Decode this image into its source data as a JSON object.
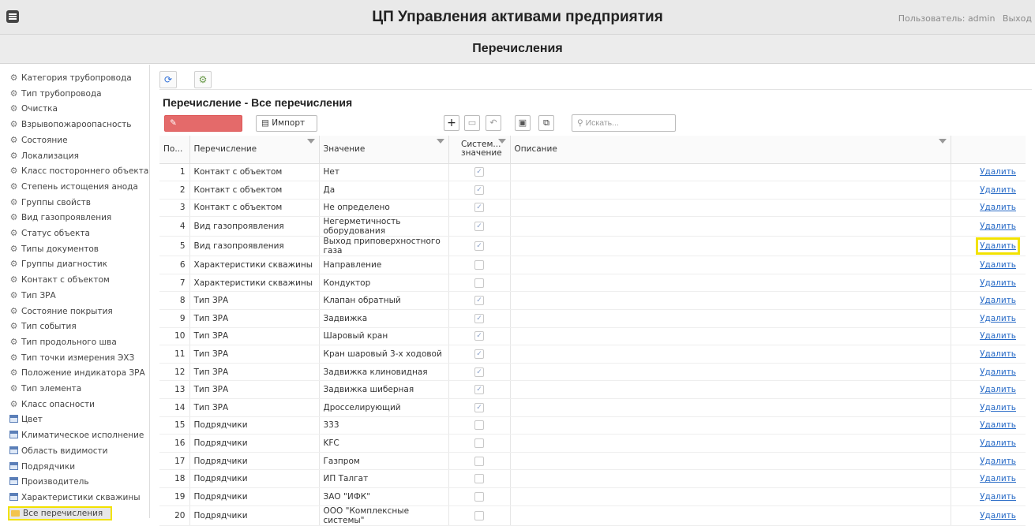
{
  "header": {
    "app_title": "ЦП Управления активами предприятия",
    "user_label": "Пользователь: admin",
    "logout_label": "Выход"
  },
  "page": {
    "title": "Перечисления"
  },
  "sidebar": {
    "items": [
      {
        "label": "Категория трубопровода",
        "icon": "gear-icon"
      },
      {
        "label": "Тип трубопровода",
        "icon": "gear-icon"
      },
      {
        "label": "Очистка",
        "icon": "gear-icon"
      },
      {
        "label": "Взрывопожароопасность",
        "icon": "gear-icon"
      },
      {
        "label": "Состояние",
        "icon": "gear-icon"
      },
      {
        "label": "Локализация",
        "icon": "gear-icon"
      },
      {
        "label": "Класс постороннего объекта",
        "icon": "gear-icon"
      },
      {
        "label": "Степень истощения анода",
        "icon": "gear-icon"
      },
      {
        "label": "Группы свойств",
        "icon": "gear-icon"
      },
      {
        "label": "Вид газопроявления",
        "icon": "gear-icon"
      },
      {
        "label": "Статус объекта",
        "icon": "gear-icon"
      },
      {
        "label": "Типы документов",
        "icon": "gear-icon"
      },
      {
        "label": "Группы диагностик",
        "icon": "gear-icon"
      },
      {
        "label": "Контакт с объектом",
        "icon": "gear-icon"
      },
      {
        "label": "Тип ЗРА",
        "icon": "gear-icon"
      },
      {
        "label": "Состояние покрытия",
        "icon": "gear-icon"
      },
      {
        "label": "Тип события",
        "icon": "gear-icon"
      },
      {
        "label": "Тип продольного шва",
        "icon": "gear-icon"
      },
      {
        "label": "Тип точки измерения ЭХЗ",
        "icon": "gear-icon"
      },
      {
        "label": "Положение индикатора ЗРА",
        "icon": "gear-icon"
      },
      {
        "label": "Тип элемента",
        "icon": "gear-icon"
      },
      {
        "label": "Класс опасности",
        "icon": "gear-icon"
      },
      {
        "label": "Цвет",
        "icon": "table-icon"
      },
      {
        "label": "Климатическое исполнение",
        "icon": "table-icon"
      },
      {
        "label": "Область видимости",
        "icon": "table-icon"
      },
      {
        "label": "Подрядчики",
        "icon": "table-icon"
      },
      {
        "label": "Производитель",
        "icon": "table-icon"
      },
      {
        "label": "Характеристики скважины",
        "icon": "table-icon"
      },
      {
        "label": "Все перечисления",
        "icon": "folder-icon"
      }
    ]
  },
  "panel": {
    "title": "Перечисление - Все перечисления",
    "edit_label": "Редактировать",
    "import_label": "Импорт",
    "search_placeholder": "Искать..."
  },
  "table": {
    "columns": [
      "По...",
      "Перечисление",
      "Значение",
      "Систем... значение",
      "Описание"
    ],
    "delete_label": "Удалить",
    "rows": [
      {
        "n": "1",
        "enum": "Контакт с объектом",
        "value": "Нет",
        "sys": true
      },
      {
        "n": "2",
        "enum": "Контакт с объектом",
        "value": "Да",
        "sys": true
      },
      {
        "n": "3",
        "enum": "Контакт с объектом",
        "value": "Не определено",
        "sys": true
      },
      {
        "n": "4",
        "enum": "Вид газопроявления",
        "value": "Негерметичность оборудования",
        "sys": true
      },
      {
        "n": "5",
        "enum": "Вид газопроявления",
        "value": "Выход приповерхностного газа",
        "sys": true
      },
      {
        "n": "6",
        "enum": "Характеристики скважины",
        "value": "Направление",
        "sys": false
      },
      {
        "n": "7",
        "enum": "Характеристики скважины",
        "value": "Кондуктор",
        "sys": false
      },
      {
        "n": "8",
        "enum": "Тип ЗРА",
        "value": "Клапан обратный",
        "sys": true
      },
      {
        "n": "9",
        "enum": "Тип ЗРА",
        "value": "Задвижка",
        "sys": true
      },
      {
        "n": "10",
        "enum": "Тип ЗРА",
        "value": "Шаровый кран",
        "sys": true
      },
      {
        "n": "11",
        "enum": "Тип ЗРА",
        "value": "Кран шаровый 3-х ходовой",
        "sys": true
      },
      {
        "n": "12",
        "enum": "Тип ЗРА",
        "value": "Задвижка клиновидная",
        "sys": true
      },
      {
        "n": "13",
        "enum": "Тип ЗРА",
        "value": "Задвижка шиберная",
        "sys": true
      },
      {
        "n": "14",
        "enum": "Тип ЗРА",
        "value": "Дросселирующий",
        "sys": true
      },
      {
        "n": "15",
        "enum": "Подрядчики",
        "value": "333",
        "sys": false
      },
      {
        "n": "16",
        "enum": "Подрядчики",
        "value": "KFC",
        "sys": false
      },
      {
        "n": "17",
        "enum": "Подрядчики",
        "value": "Газпром",
        "sys": false
      },
      {
        "n": "18",
        "enum": "Подрядчики",
        "value": "ИП Талгат",
        "sys": false
      },
      {
        "n": "19",
        "enum": "Подрядчики",
        "value": "ЗАО \"ИФК\"",
        "sys": false
      },
      {
        "n": "20",
        "enum": "Подрядчики",
        "value": "ООО \"Комплексные системы\"",
        "sys": false
      }
    ]
  }
}
